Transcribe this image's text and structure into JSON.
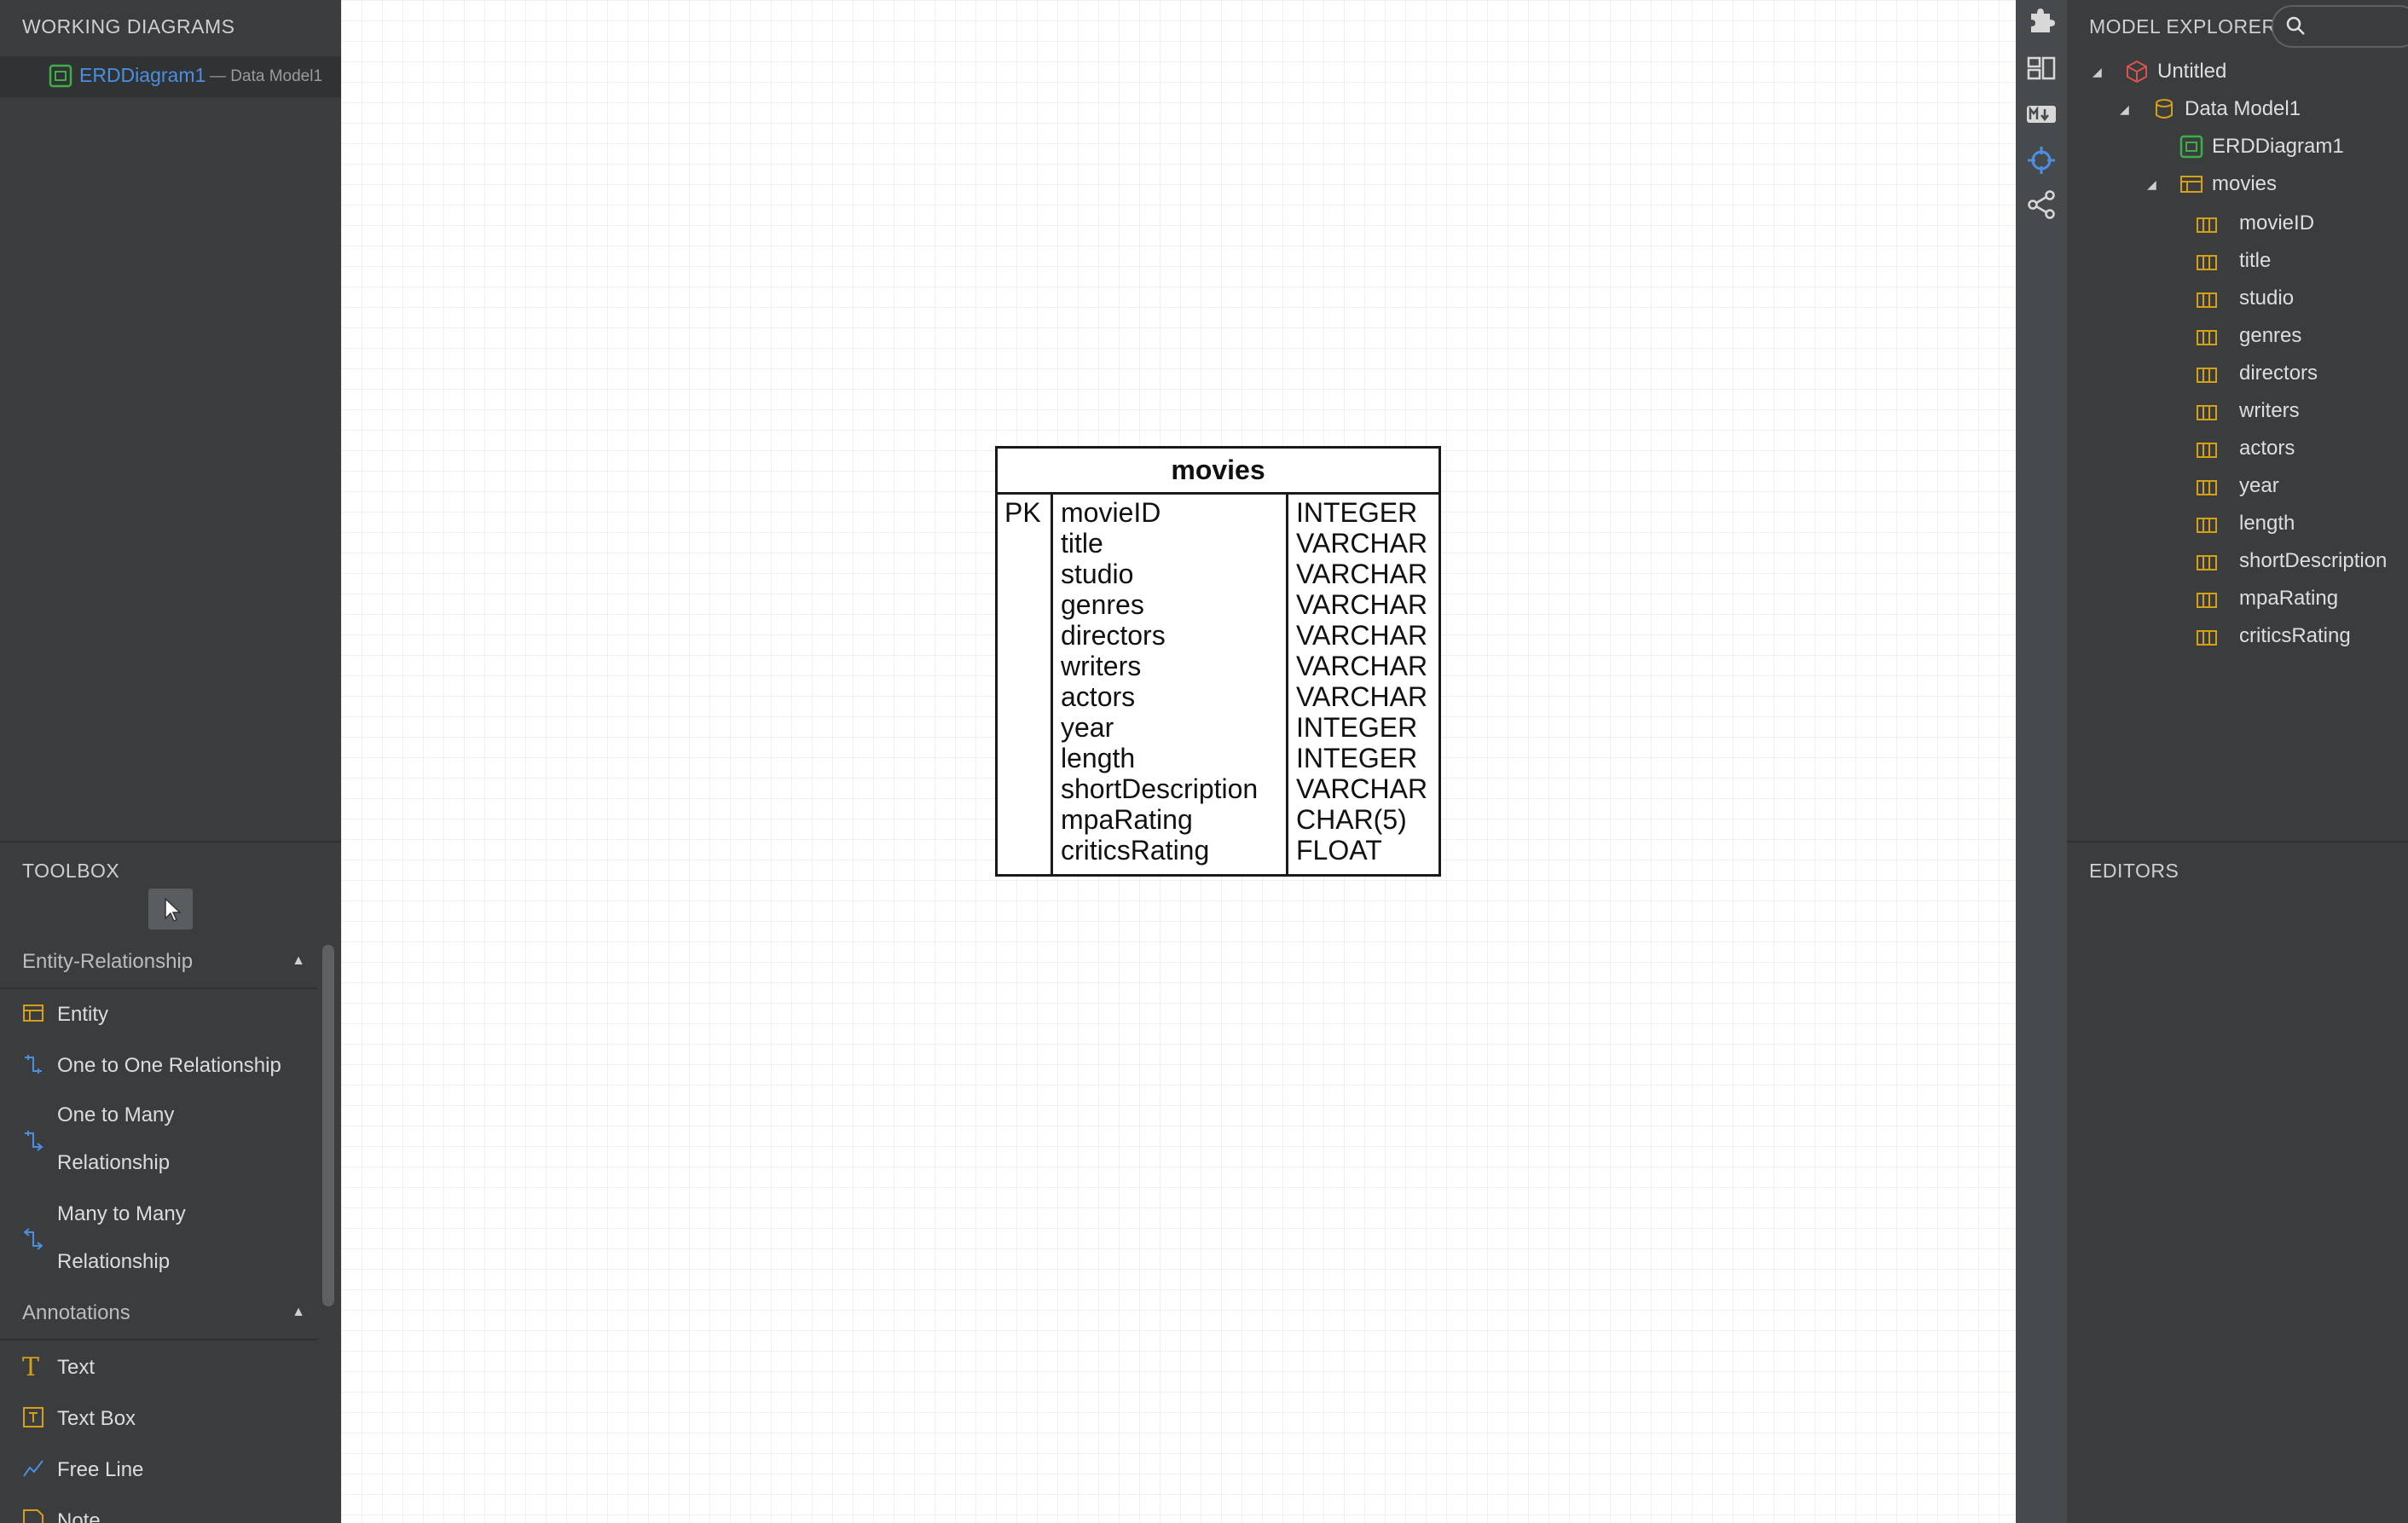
{
  "working_diagrams": {
    "title": "WORKING DIAGRAMS",
    "item": {
      "name": "ERDDiagram1",
      "model": "— Data Model1"
    }
  },
  "toolbox": {
    "title": "TOOLBOX",
    "groups": [
      {
        "label": "Entity-Relationship",
        "tools": [
          "Entity",
          "One to One Relationship",
          "One to Many",
          "Relationship",
          "Many to Many",
          "Relationship"
        ]
      },
      {
        "label": "Annotations",
        "tools": [
          "Text",
          "Text Box",
          "Free Line",
          "Note"
        ]
      }
    ]
  },
  "entity": {
    "name": "movies",
    "pk_label": "PK",
    "columns": [
      {
        "name": "movieID",
        "type": "INTEGER"
      },
      {
        "name": "title",
        "type": "VARCHAR"
      },
      {
        "name": "studio",
        "type": "VARCHAR"
      },
      {
        "name": "genres",
        "type": "VARCHAR"
      },
      {
        "name": "directors",
        "type": "VARCHAR"
      },
      {
        "name": "writers",
        "type": "VARCHAR"
      },
      {
        "name": "actors",
        "type": "VARCHAR"
      },
      {
        "name": "year",
        "type": "INTEGER"
      },
      {
        "name": "length",
        "type": "INTEGER"
      },
      {
        "name": "shortDescription",
        "type": "VARCHAR"
      },
      {
        "name": "mpaRating",
        "type": "CHAR(5)"
      },
      {
        "name": "criticsRating",
        "type": "FLOAT"
      }
    ]
  },
  "side_icons": [
    "puzzle-icon",
    "layout-icon",
    "markdown-icon",
    "crosshair-icon",
    "share-icon"
  ],
  "model_explorer": {
    "title": "MODEL EXPLORER",
    "root": "Untitled",
    "model": "Data Model1",
    "diagram": "ERDDiagram1",
    "table": "movies",
    "columns": [
      "movieID",
      "title",
      "studio",
      "genres",
      "directors",
      "writers",
      "actors",
      "year",
      "length",
      "shortDescription",
      "mpaRating",
      "criticsRating"
    ]
  },
  "editors": {
    "title": "EDITORS"
  },
  "colors": {
    "accent": "#4a8fe0",
    "entity_icon": "#d4a017",
    "diagram_icon": "#3fae49",
    "project_icon": "#d9534f"
  }
}
